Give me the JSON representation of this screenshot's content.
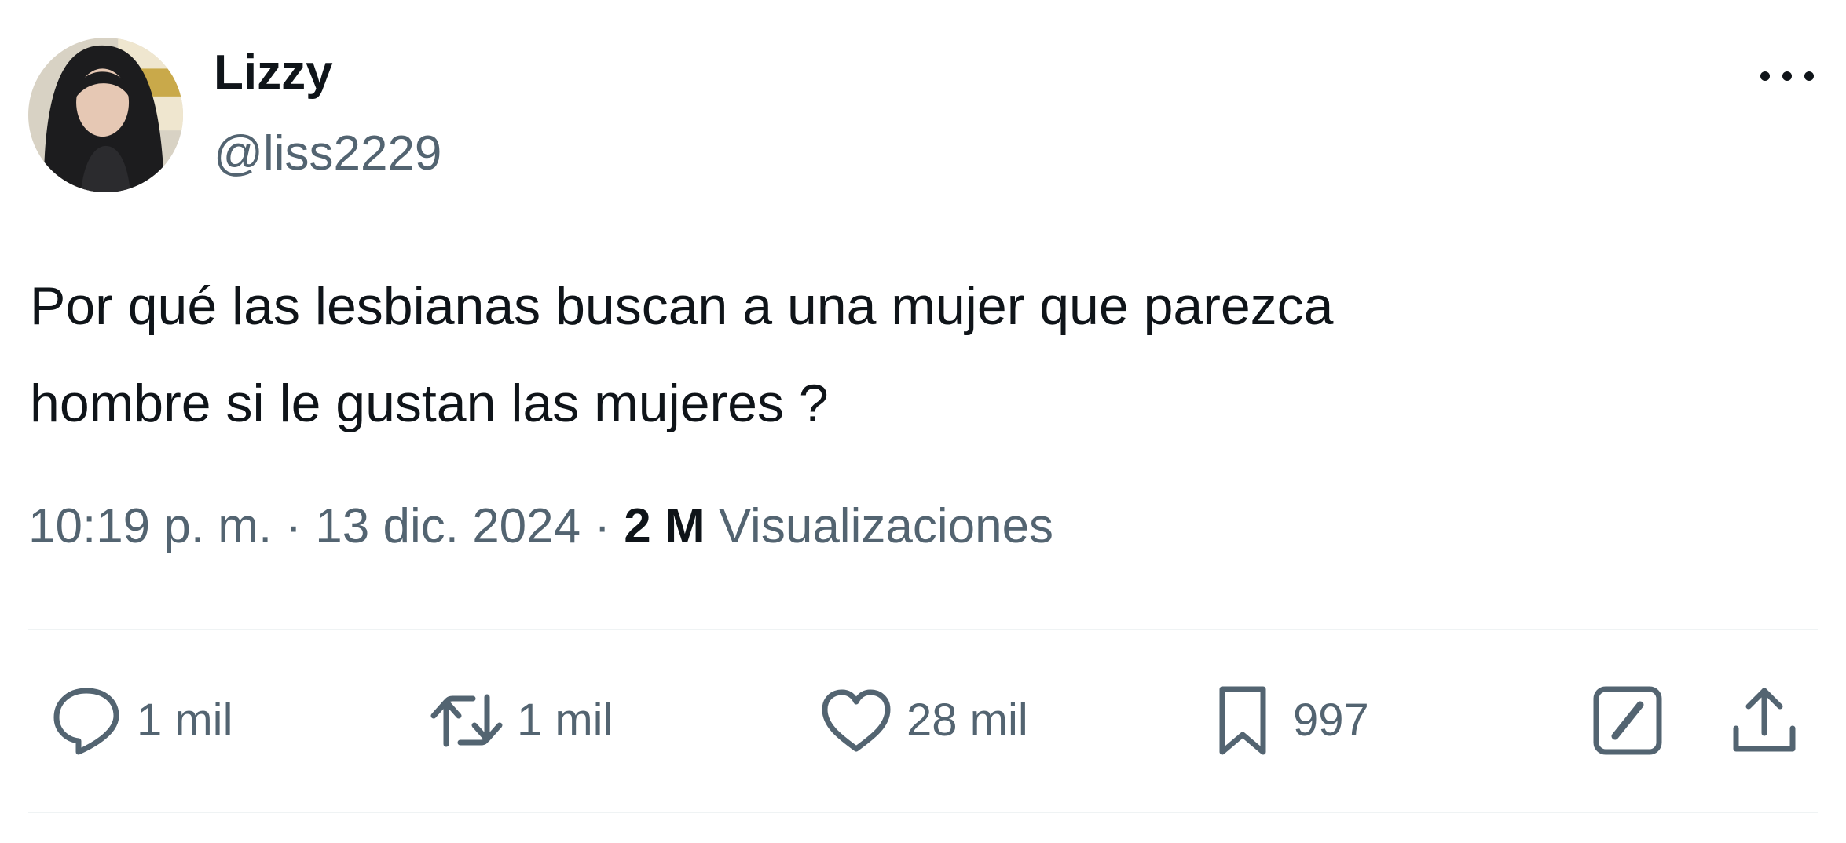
{
  "tweet": {
    "author": {
      "display_name": "Lizzy",
      "handle": "@liss2229"
    },
    "text_lines": [
      "Por qué las lesbianas buscan a una mujer que parezca",
      "hombre si le gustan las mujeres ?"
    ],
    "time": "10:19 p. m.",
    "separator": " · ",
    "date": "13 dic. 2024",
    "views_count": "2 M",
    "views_label": "Visualizaciones"
  },
  "actions": {
    "reply": {
      "icon": "reply-icon",
      "count": "1 mil"
    },
    "retweet": {
      "icon": "retweet-icon",
      "count": "1 mil"
    },
    "like": {
      "icon": "heart-icon",
      "count": "28 mil"
    },
    "bookmark": {
      "icon": "bookmark-icon",
      "count": "997"
    },
    "grok": {
      "icon": "grok-icon"
    },
    "share": {
      "icon": "share-icon"
    }
  },
  "colors": {
    "text_primary": "#0f1419",
    "text_secondary": "#536471",
    "divider": "#eff3f4"
  }
}
